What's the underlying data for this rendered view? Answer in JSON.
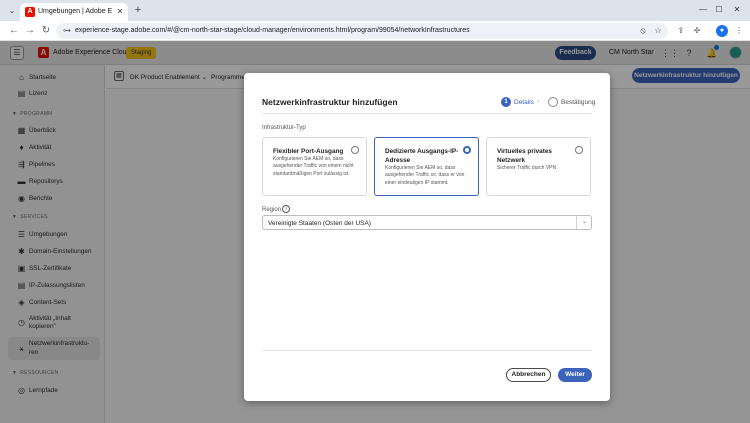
{
  "browser": {
    "tab_title": "Umgebungen | Adobe Experien",
    "tab_favicon": "A",
    "url": "experience-stage.adobe.com/#/@cm-north-star-stage/cloud-manager/environments.html/program/99054/networkInfrastructures",
    "tabstrip_chevron": "⌄",
    "tab_close": "✕",
    "new_tab": "+",
    "minimize": "—",
    "maximize": "☐",
    "close": "✕",
    "back": "←",
    "forward": "→",
    "reload": "↻",
    "site_info": "⊶",
    "eye_off": "⦸",
    "star": "☆",
    "share": "⇪",
    "extensions": "✢",
    "profile": "●",
    "menu": "⋮"
  },
  "header": {
    "menu_icon": "☰",
    "logo": "A",
    "app_name": "Adobe Experience Cloud",
    "environment_badge": "Staging",
    "feedback": "Feedback",
    "org_name": "CM North Star",
    "apps_icon": "⋮⋮",
    "help_icon": "?",
    "bell_icon": "🔔"
  },
  "sidebar": {
    "items_top": [
      {
        "icon": "⌂",
        "label": "Startseite"
      },
      {
        "icon": "▤",
        "label": "Lizenz"
      }
    ],
    "program_header": "PROGRAMM",
    "program_items": [
      {
        "icon": "▦",
        "label": "Überblick"
      },
      {
        "icon": "♦",
        "label": "Aktivität"
      },
      {
        "icon": "⇶",
        "label": "Pipelines"
      },
      {
        "icon": "▬",
        "label": "Repositorys"
      },
      {
        "icon": "◉",
        "label": "Berichte"
      }
    ],
    "services_header": "SERVICES",
    "services_items": [
      {
        "icon": "☰",
        "label": "Umgebungen"
      },
      {
        "icon": "✱",
        "label": "Domain-Einstellungen"
      },
      {
        "icon": "▣",
        "label": "SSL-Zertifikate"
      },
      {
        "icon": "▤",
        "label": "IP-Zulassungslisten"
      },
      {
        "icon": "◈",
        "label": "Content-Sets"
      },
      {
        "icon": "◷",
        "label": "Aktivität „Inhalt",
        "label2": "kopieren”"
      },
      {
        "icon": "⚹",
        "label": "Netzwerkinfrastruktu-",
        "label2": "ren"
      }
    ],
    "resources_header": "RESSOURCEN",
    "resources_items": [
      {
        "icon": "◎",
        "label": "Lernpfade"
      }
    ]
  },
  "subnav": {
    "program_icon": "▦",
    "program_name": "DK Product Enablement",
    "chevron": "⌄",
    "breadcrumb": "Programme",
    "add_button": "Netzwerkinfrastruktur hinzufügen"
  },
  "modal": {
    "title": "Netzwerkinfrastruktur hinzufügen",
    "steps": [
      {
        "number": "1",
        "label": "Details",
        "active": true
      },
      {
        "label": "Bestätigung",
        "active": false
      }
    ],
    "step_separator": "›",
    "infra_type_label": "Infrastruktur-Typ",
    "options": [
      {
        "title": "Flexibler Port-Ausgang",
        "description": "Konfigurieren Sie AEM so, dass ausgehender Traffic von einem nicht standardmäßigen Port zulässig ist.",
        "selected": false
      },
      {
        "title": "Dedizierte Ausgangs-IP-Adresse",
        "description": "Konfigurieren Sie AEM so, dass ausgehender Traffic so, dass er von einer eindeutigen IP stammt.",
        "selected": true
      },
      {
        "title": "Virtuelles privates Netzwerk",
        "description": "Sicherer Traffic durch VPN",
        "selected": false
      }
    ],
    "region_label": "Region",
    "region_info_icon": "i",
    "region_value": "Vereinigte Staaten (Osten der USA)",
    "region_chevron": "⌄",
    "cancel": "Abbrechen",
    "next": "Weiter"
  },
  "colors": {
    "accent": "#3b63bb",
    "header_blue": "#2a4e83",
    "adobe_red": "#eb1000",
    "staging": "#f5c518"
  }
}
